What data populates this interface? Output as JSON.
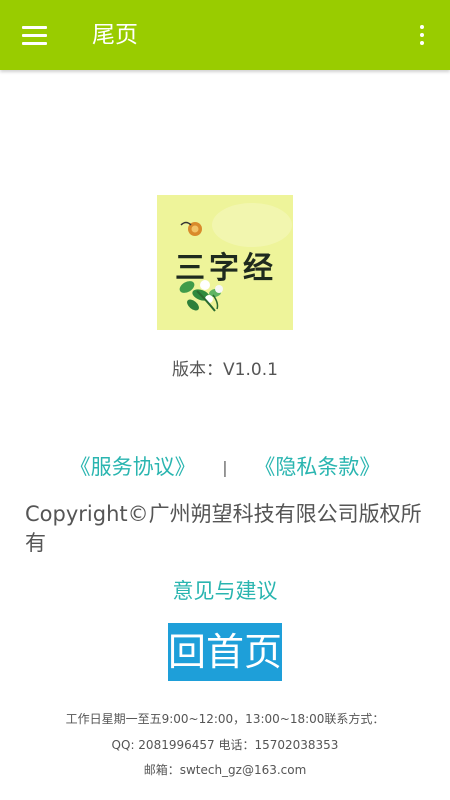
{
  "app_bar": {
    "title": "尾页",
    "menu_icon": "hamburger-menu-icon",
    "overflow_icon": "more-vert-icon",
    "color": "#99cc00"
  },
  "about": {
    "logo_text": "三字经",
    "version": "版本：V1.0.1",
    "service_agreement": "《服务协议》",
    "separator": "|",
    "privacy_policy": "《隐私条款》",
    "copyright": "Copyright©广州朔望科技有限公司版权所有",
    "feedback": "意见与建议",
    "home_button": "回首页",
    "link_color": "#2ab5b0",
    "button_color": "#1e9fd9"
  },
  "footer": {
    "hours": "工作日星期一至五9:00~12:00，13:00~18:00联系方式：",
    "contact": "QQ: 2081996457 电话：15702038353",
    "email": "邮箱：swtech_gz@163.com"
  }
}
